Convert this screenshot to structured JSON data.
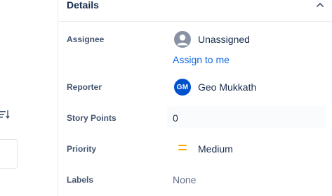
{
  "details": {
    "title": "Details",
    "fields": {
      "assignee": {
        "label": "Assignee",
        "value": "Unassigned",
        "action": "Assign to me"
      },
      "reporter": {
        "label": "Reporter",
        "value": "Geo Mukkath",
        "initials": "GM"
      },
      "story_points": {
        "label": "Story Points",
        "value": "0"
      },
      "priority": {
        "label": "Priority",
        "value": "Medium",
        "icon": "priority-medium-icon",
        "color": "#ffab00"
      },
      "labels": {
        "label": "Labels",
        "value": "None"
      }
    }
  },
  "colors": {
    "link": "#0c66e4",
    "reporter_avatar": "#0052cc",
    "default_avatar": "#8993a4"
  }
}
